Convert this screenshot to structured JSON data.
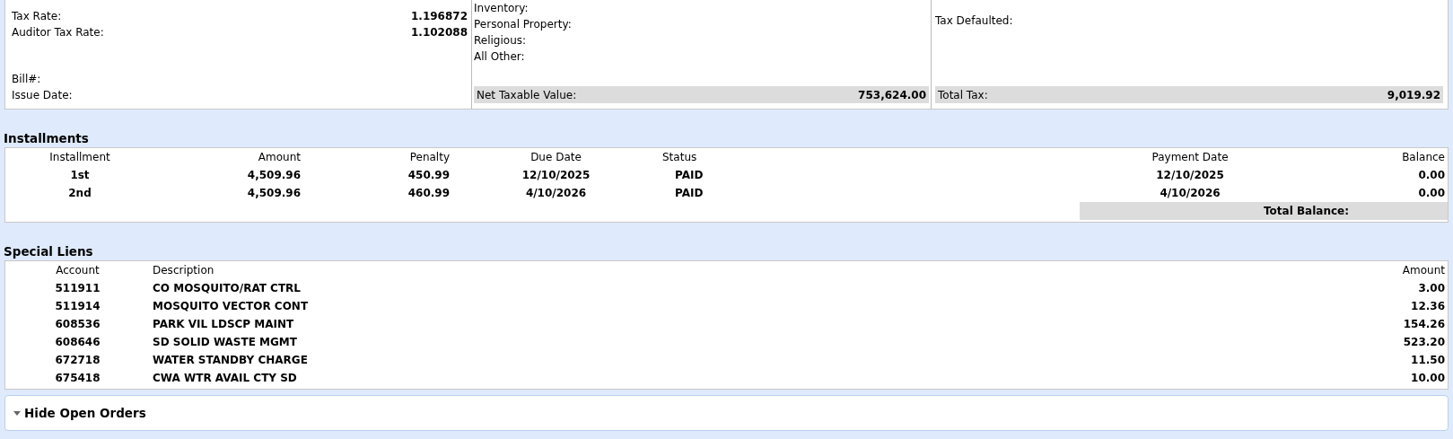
{
  "summary": {
    "rates": [
      {
        "label": "Tax Rate:",
        "value": "1.196872"
      },
      {
        "label": "Auditor Tax Rate:",
        "value": "1.102088"
      }
    ],
    "bill_fields": [
      {
        "label": "Bill#:"
      },
      {
        "label": "Issue Date:"
      }
    ],
    "exemptions": [
      {
        "label": "Inventory:"
      },
      {
        "label": "Personal Property:"
      },
      {
        "label": "Religious:"
      },
      {
        "label": "All Other:"
      }
    ],
    "net_taxable_value": {
      "label": "Net Taxable Value:",
      "value": "753,624.00"
    },
    "tax_defaulted": {
      "label": "Tax Defaulted:"
    },
    "total_tax": {
      "label": "Total Tax:",
      "value": "9,019.92"
    }
  },
  "installments": {
    "title": "Installments",
    "columns": [
      "Installment",
      "Amount",
      "Penalty",
      "Due Date",
      "Status",
      "Payment Date",
      "Balance"
    ],
    "rows": [
      [
        "1st",
        "4,509.96",
        "450.99",
        "12/10/2025",
        "PAID",
        "12/10/2025",
        "0.00"
      ],
      [
        "2nd",
        "4,509.96",
        "460.99",
        "4/10/2026",
        "PAID",
        "4/10/2026",
        "0.00"
      ]
    ],
    "total_balance": {
      "label": "Total Balance:"
    }
  },
  "special_liens": {
    "title": "Special Liens",
    "columns": [
      "Account",
      "Description",
      "Amount"
    ],
    "rows": [
      [
        "511911",
        "CO MOSQUITO/RAT CTRL",
        "3.00"
      ],
      [
        "511914",
        "MOSQUITO VECTOR CONT",
        "12.36"
      ],
      [
        "608536",
        "PARK VIL LDSCP MAINT",
        "154.26"
      ],
      [
        "608646",
        "SD SOLID WASTE MGMT",
        "523.20"
      ],
      [
        "672718",
        "WATER STANDBY CHARGE",
        "11.50"
      ],
      [
        "675418",
        "CWA WTR AVAIL CTY SD",
        "10.00"
      ]
    ]
  },
  "open_orders": {
    "label": "Hide Open Orders",
    "expanded": true
  }
}
